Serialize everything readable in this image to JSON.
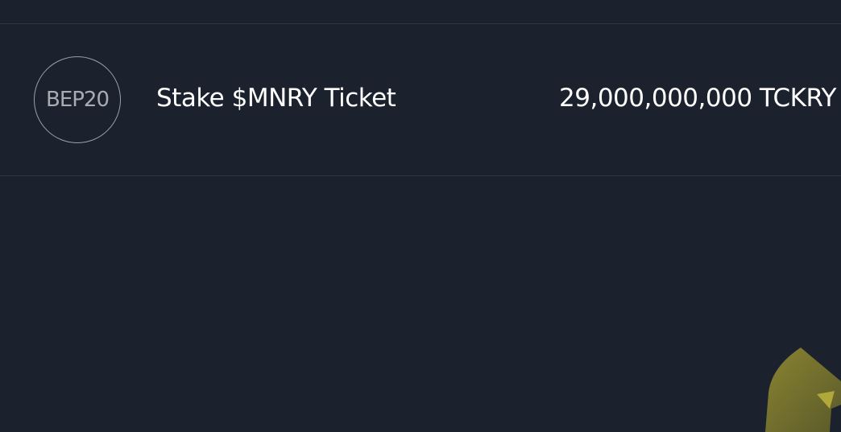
{
  "token_row": {
    "badge": "BEP20",
    "name": "Stake $MNRY Ticket",
    "amount": "29,000,000,000 TCKRY"
  },
  "colors": {
    "background": "#1b222d",
    "divider": "#2e3642",
    "text": "#ffffff",
    "badge_text": "#a7acb3",
    "badge_border": "#9aa0a8",
    "decoration": "#6b6a2c"
  },
  "icons": {
    "decoration": "pointer-shape-icon"
  }
}
